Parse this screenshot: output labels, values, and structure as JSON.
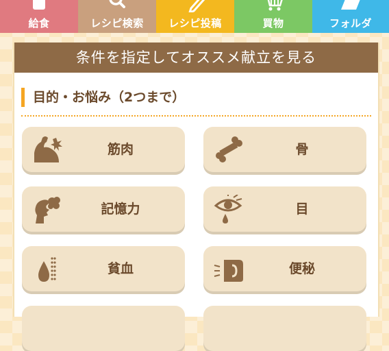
{
  "nav": {
    "tabs": [
      {
        "label": "給食",
        "icon": "lunch-icon",
        "color": "#e07a80"
      },
      {
        "label": "レシピ検索",
        "icon": "search-icon",
        "color": "#c9a07e"
      },
      {
        "label": "レシピ投稿",
        "icon": "pencil-icon",
        "color": "#f3b81f"
      },
      {
        "label": "買物",
        "icon": "cart-icon",
        "color": "#7cc864"
      },
      {
        "label": "フォルダ",
        "icon": "folder-icon",
        "color": "#3fb8e8"
      }
    ]
  },
  "panel": {
    "header": "条件を指定してオススメ献立を見る",
    "section_title": "目的・お悩み（2つまで）",
    "options": [
      {
        "label": "筋肉",
        "icon": "muscle-icon"
      },
      {
        "label": "骨",
        "icon": "bone-icon"
      },
      {
        "label": "記憶力",
        "icon": "brain-icon"
      },
      {
        "label": "目",
        "icon": "eye-icon"
      },
      {
        "label": "貧血",
        "icon": "blood-drop-icon"
      },
      {
        "label": "便秘",
        "icon": "intestine-icon"
      }
    ]
  },
  "colors": {
    "brown": "#8e6a46",
    "text_brown": "#6b4a2c",
    "accent_orange": "#f5a623",
    "tile_bg": "#f2e3c9",
    "page_bg": "#fbe7c1"
  }
}
